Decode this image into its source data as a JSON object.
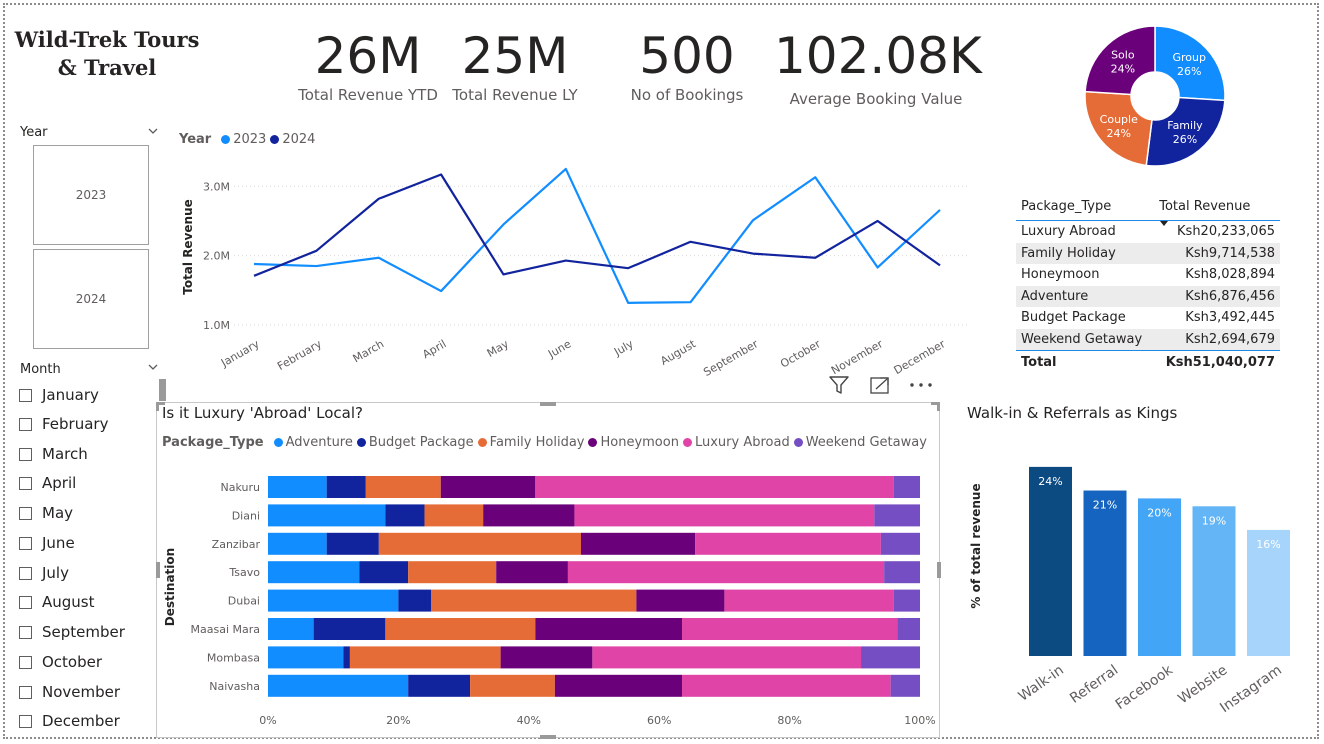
{
  "report_title": "Wild-Trek Tours & Travel",
  "kpis": [
    {
      "value": "26M",
      "label": "Total Revenue YTD"
    },
    {
      "value": "25M",
      "label": "Total Revenue LY"
    },
    {
      "value": "500",
      "label": "No of Bookings"
    },
    {
      "value": "102.08K",
      "label": "Average Booking Value"
    }
  ],
  "year_slicer": {
    "header": "Year",
    "options": [
      "2023",
      "2024"
    ]
  },
  "month_slicer": {
    "header": "Month",
    "options": [
      "January",
      "February",
      "March",
      "April",
      "May",
      "June",
      "July",
      "August",
      "September",
      "October",
      "November",
      "December"
    ]
  },
  "colors": {
    "series_2023": "#118dff",
    "series_2024": "#12239e",
    "adventure": "#118dff",
    "budget_package": "#12239e",
    "family_holiday": "#e66c37",
    "honeymoon": "#6b007b",
    "luxury_abroad": "#e044a7",
    "weekend_getaway": "#744ec2"
  },
  "package_table": {
    "headers": [
      "Package_Type",
      "Total Revenue"
    ],
    "rows": [
      [
        "Luxury Abroad",
        "Ksh20,233,065"
      ],
      [
        "Family Holiday",
        "Ksh9,714,538"
      ],
      [
        "Honeymoon",
        "Ksh8,028,894"
      ],
      [
        "Adventure",
        "Ksh6,876,456"
      ],
      [
        "Budget Package",
        "Ksh3,492,445"
      ],
      [
        "Weekend Getaway",
        "Ksh2,694,679"
      ]
    ],
    "total": [
      "Total",
      "Ksh51,040,077"
    ]
  },
  "visual_icons": [
    "filter-icon",
    "focus-mode-icon",
    "more-options-icon"
  ],
  "chart_data": [
    {
      "type": "line",
      "title": "",
      "legend_title": "Year",
      "legend_position": "top-left",
      "xlabel": "",
      "ylabel": "Total Revenue",
      "categories": [
        "January",
        "February",
        "March",
        "April",
        "May",
        "June",
        "July",
        "August",
        "September",
        "October",
        "November",
        "December"
      ],
      "yticks": [
        "1.0M",
        "2.0M",
        "3.0M"
      ],
      "ylim": [
        0.9,
        3.35
      ],
      "grid": true,
      "series": [
        {
          "name": "2023",
          "values": [
            1.88,
            1.85,
            1.97,
            1.49,
            2.45,
            3.25,
            1.32,
            1.33,
            2.51,
            3.13,
            1.83,
            2.66
          ]
        },
        {
          "name": "2024",
          "values": [
            1.71,
            2.07,
            2.82,
            3.17,
            1.73,
            1.93,
            1.82,
            2.2,
            2.03,
            1.97,
            2.5,
            1.86
          ]
        }
      ]
    },
    {
      "type": "pie",
      "donut": true,
      "title": "",
      "slices": [
        {
          "name": "Group",
          "value": 26,
          "label": "26%"
        },
        {
          "name": "Family",
          "value": 26,
          "label": "26%"
        },
        {
          "name": "Couple",
          "value": 24,
          "label": "24%"
        },
        {
          "name": "Solo",
          "value": 24,
          "label": "24%"
        }
      ],
      "colors": [
        "#118dff",
        "#12239e",
        "#e66c37",
        "#6b007b"
      ]
    },
    {
      "type": "bar",
      "orientation": "horizontal",
      "stacked": "100%",
      "title": "Is it Luxury 'Abroad' Local?",
      "legend_title": "Package_Type",
      "legend_position": "top-left",
      "ylabel": "Destination",
      "xlabel": "",
      "xticks": [
        "0%",
        "20%",
        "40%",
        "60%",
        "80%",
        "100%"
      ],
      "categories": [
        "Nakuru",
        "Diani",
        "Zanzibar",
        "Tsavo",
        "Dubai",
        "Maasai Mara",
        "Mombasa",
        "Naivasha"
      ],
      "series": [
        {
          "name": "Adventure",
          "values": [
            9,
            18,
            9,
            14,
            20,
            7,
            11.5,
            21.5
          ]
        },
        {
          "name": "Budget Package",
          "values": [
            6,
            6,
            8,
            7.5,
            5,
            11,
            1,
            9.5
          ]
        },
        {
          "name": "Family Holiday",
          "values": [
            11.5,
            9,
            31,
            13.5,
            31.5,
            23,
            23,
            13
          ]
        },
        {
          "name": "Honeymoon",
          "values": [
            14.5,
            14,
            17.5,
            11,
            13.5,
            22.5,
            14,
            19.5
          ]
        },
        {
          "name": "Luxury Abroad",
          "values": [
            55,
            46,
            28.5,
            48.5,
            26,
            33,
            41,
            32
          ]
        },
        {
          "name": "Weekend Getaway",
          "values": [
            4,
            7,
            6,
            5.5,
            4,
            3.5,
            9,
            4.5
          ]
        }
      ]
    },
    {
      "type": "bar",
      "title": "Walk-in & Referrals as Kings",
      "xlabel": "",
      "ylabel": "% of total revenue",
      "categories": [
        "Walk-in",
        "Referral",
        "Facebook",
        "Website",
        "Instagram"
      ],
      "values": [
        24,
        21,
        20,
        19,
        16
      ],
      "labels": [
        "24%",
        "21%",
        "20%",
        "19%",
        "16%"
      ],
      "ylim": [
        0,
        25
      ],
      "colors": [
        "#0c4a82",
        "#1565c0",
        "#42a5f5",
        "#64b5f6",
        "#a6d4fb"
      ]
    }
  ]
}
